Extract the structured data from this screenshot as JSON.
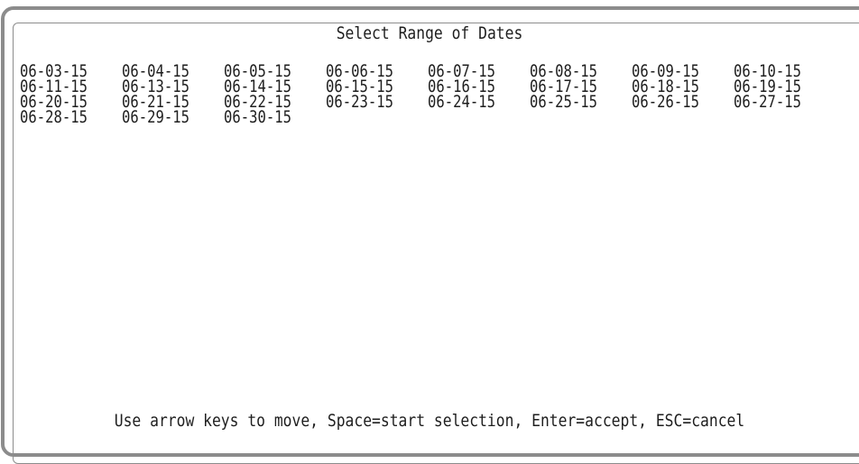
{
  "dialog": {
    "title": "Select Range of Dates",
    "dates": [
      "06-03-15",
      "06-04-15",
      "06-05-15",
      "06-06-15",
      "06-07-15",
      "06-08-15",
      "06-09-15",
      "06-10-15",
      "06-11-15",
      "06-13-15",
      "06-14-15",
      "06-15-15",
      "06-16-15",
      "06-17-15",
      "06-18-15",
      "06-19-15",
      "06-20-15",
      "06-21-15",
      "06-22-15",
      "06-23-15",
      "06-24-15",
      "06-25-15",
      "06-26-15",
      "06-27-15",
      "06-28-15",
      "06-29-15",
      "06-30-15"
    ],
    "footer": "Use arrow keys to move, Space=start selection, Enter=accept, ESC=cancel"
  }
}
